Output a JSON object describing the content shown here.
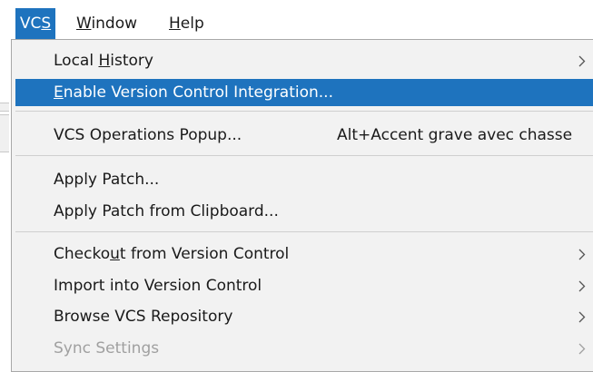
{
  "menubar": {
    "items": [
      {
        "label": "VCS",
        "mnemonic_index": 2,
        "active": true
      },
      {
        "label": "Window",
        "mnemonic_index": 0,
        "active": false
      },
      {
        "label": "Help",
        "mnemonic_index": 0,
        "active": false
      }
    ]
  },
  "dropdown": {
    "items": [
      {
        "label": "Local History",
        "mnemonic_index": 6,
        "submenu": true,
        "highlighted": false,
        "disabled": false,
        "shortcut": ""
      },
      {
        "label": "Enable Version Control Integration...",
        "mnemonic_index": 0,
        "submenu": false,
        "highlighted": true,
        "disabled": false,
        "shortcut": ""
      },
      {
        "label": "VCS Operations Popup...",
        "mnemonic_index": -1,
        "submenu": false,
        "highlighted": false,
        "disabled": false,
        "shortcut": "Alt+Accent grave avec chasse"
      },
      {
        "label": "Apply Patch...",
        "mnemonic_index": -1,
        "submenu": false,
        "highlighted": false,
        "disabled": false,
        "shortcut": ""
      },
      {
        "label": "Apply Patch from Clipboard...",
        "mnemonic_index": -1,
        "submenu": false,
        "highlighted": false,
        "disabled": false,
        "shortcut": ""
      },
      {
        "label": "Checkout from Version Control",
        "mnemonic_index": 6,
        "submenu": true,
        "highlighted": false,
        "disabled": false,
        "shortcut": ""
      },
      {
        "label": "Import into Version Control",
        "mnemonic_index": -1,
        "submenu": true,
        "highlighted": false,
        "disabled": false,
        "shortcut": ""
      },
      {
        "label": "Browse VCS Repository",
        "mnemonic_index": -1,
        "submenu": true,
        "highlighted": false,
        "disabled": false,
        "shortcut": ""
      },
      {
        "label": "Sync Settings",
        "mnemonic_index": -1,
        "submenu": true,
        "highlighted": false,
        "disabled": true,
        "shortcut": ""
      }
    ]
  },
  "colors": {
    "highlight": "#1e73be",
    "menu_background": "#f2f2f2",
    "disabled_text": "#a0a0a0",
    "separator": "#cfcfcf"
  },
  "icons": {
    "submenu": "chevron-right-icon"
  }
}
